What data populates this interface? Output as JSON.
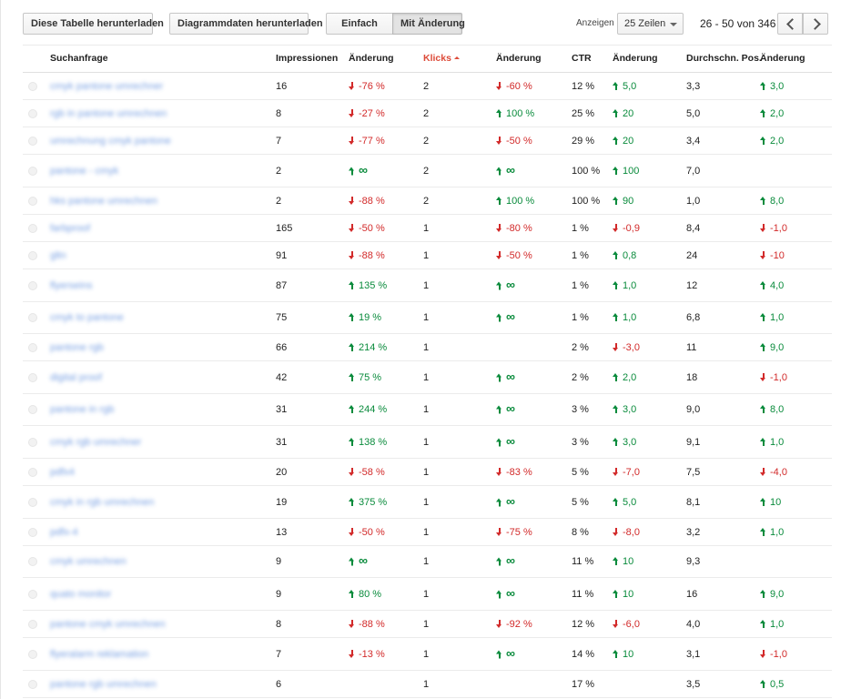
{
  "toolbar": {
    "download_table": "Diese Tabelle herunterladen",
    "download_chart": "Diagrammdaten herunterladen",
    "view_simple": "Einfach",
    "view_with_change": "Mit Änderung",
    "show_label": "Anzeigen",
    "rows_select": "25 Zeilen",
    "page_info": "26 - 50 von 346"
  },
  "columns": {
    "query": "Suchanfrage",
    "impressions": "Impressionen",
    "imp_change": "Änderung",
    "clicks": "Klicks",
    "clicks_change": "Änderung",
    "ctr": "CTR",
    "ctr_change": "Änderung",
    "avg_pos": "Durchschn. Pos.",
    "pos_change": "Änderung"
  },
  "rows": [
    {
      "query": "cmyk pantone umrechner",
      "imp": "16",
      "imp_chg": "-76 %",
      "imp_dir": "down",
      "clk": "2",
      "clk_chg": "-60 %",
      "clk_dir": "down",
      "ctr": "12 %",
      "ctr_chg": "5,0",
      "ctr_dir": "up",
      "pos": "3,3",
      "pos_chg": "3,0",
      "pos_dir": "up",
      "h": 30
    },
    {
      "query": "rgb in pantone umrechnen",
      "imp": "8",
      "imp_chg": "-27 %",
      "imp_dir": "down",
      "clk": "2",
      "clk_chg": "100 %",
      "clk_dir": "up",
      "ctr": "25 %",
      "ctr_chg": "20",
      "ctr_dir": "up",
      "pos": "5,0",
      "pos_chg": "2,0",
      "pos_dir": "up",
      "h": 30
    },
    {
      "query": "umrechnung cmyk pantone",
      "imp": "7",
      "imp_chg": "-77 %",
      "imp_dir": "down",
      "clk": "2",
      "clk_chg": "-50 %",
      "clk_dir": "down",
      "ctr": "29 %",
      "ctr_chg": "20",
      "ctr_dir": "up",
      "pos": "3,4",
      "pos_chg": "2,0",
      "pos_dir": "up",
      "h": 30
    },
    {
      "query": "pantone - cmyk",
      "imp": "2",
      "imp_chg": "∞",
      "imp_dir": "up",
      "clk": "2",
      "clk_chg": "∞",
      "clk_dir": "up",
      "ctr": "100 %",
      "ctr_chg": "100",
      "ctr_dir": "up",
      "pos": "7,0",
      "pos_chg": "",
      "pos_dir": "",
      "h": 36
    },
    {
      "query": "hks pantone umrechnen",
      "imp": "2",
      "imp_chg": "-88 %",
      "imp_dir": "down",
      "clk": "2",
      "clk_chg": "100 %",
      "clk_dir": "up",
      "ctr": "100 %",
      "ctr_chg": "90",
      "ctr_dir": "up",
      "pos": "1,0",
      "pos_chg": "8,0",
      "pos_dir": "up",
      "h": 30
    },
    {
      "query": "farbproof",
      "imp": "165",
      "imp_chg": "-50 %",
      "imp_dir": "down",
      "clk": "1",
      "clk_chg": "-80 %",
      "clk_dir": "down",
      "ctr": "1 %",
      "ctr_chg": "-0,9",
      "ctr_dir": "down",
      "pos": "8,4",
      "pos_chg": "-1,0",
      "pos_dir": "down",
      "h": 30
    },
    {
      "query": "gltn",
      "imp": "91",
      "imp_chg": "-88 %",
      "imp_dir": "down",
      "clk": "1",
      "clk_chg": "-50 %",
      "clk_dir": "down",
      "ctr": "1 %",
      "ctr_chg": "0,8",
      "ctr_dir": "up",
      "pos": "24",
      "pos_chg": "-10",
      "pos_dir": "down",
      "h": 30
    },
    {
      "query": "flyerseins",
      "imp": "87",
      "imp_chg": "135 %",
      "imp_dir": "up",
      "clk": "1",
      "clk_chg": "∞",
      "clk_dir": "up",
      "ctr": "1 %",
      "ctr_chg": "1,0",
      "ctr_dir": "up",
      "pos": "12",
      "pos_chg": "4,0",
      "pos_dir": "up",
      "h": 36
    },
    {
      "query": "cmyk to pantone",
      "imp": "75",
      "imp_chg": "19 %",
      "imp_dir": "up",
      "clk": "1",
      "clk_chg": "∞",
      "clk_dir": "up",
      "ctr": "1 %",
      "ctr_chg": "1,0",
      "ctr_dir": "up",
      "pos": "6,8",
      "pos_chg": "1,0",
      "pos_dir": "up",
      "h": 35
    },
    {
      "query": "pantone rgb",
      "imp": "66",
      "imp_chg": "214 %",
      "imp_dir": "up",
      "clk": "1",
      "clk_chg": "",
      "clk_dir": "",
      "ctr": "2 %",
      "ctr_chg": "-3,0",
      "ctr_dir": "down",
      "pos": "11",
      "pos_chg": "9,0",
      "pos_dir": "up",
      "h": 30
    },
    {
      "query": "digital proof",
      "imp": "42",
      "imp_chg": "75 %",
      "imp_dir": "up",
      "clk": "1",
      "clk_chg": "∞",
      "clk_dir": "up",
      "ctr": "2 %",
      "ctr_chg": "2,0",
      "ctr_dir": "up",
      "pos": "18",
      "pos_chg": "-1,0",
      "pos_dir": "down",
      "h": 36
    },
    {
      "query": "pantone in rgb",
      "imp": "31",
      "imp_chg": "244 %",
      "imp_dir": "up",
      "clk": "1",
      "clk_chg": "∞",
      "clk_dir": "up",
      "ctr": "3 %",
      "ctr_chg": "3,0",
      "ctr_dir": "up",
      "pos": "9,0",
      "pos_chg": "8,0",
      "pos_dir": "up",
      "h": 35
    },
    {
      "query": "cmyk rgb umrechner",
      "imp": "31",
      "imp_chg": "138 %",
      "imp_dir": "up",
      "clk": "1",
      "clk_chg": "∞",
      "clk_dir": "up",
      "ctr": "3 %",
      "ctr_chg": "3,0",
      "ctr_dir": "up",
      "pos": "9,1",
      "pos_chg": "1,0",
      "pos_dir": "up",
      "h": 36
    },
    {
      "query": "pdfx4",
      "imp": "20",
      "imp_chg": "-58 %",
      "imp_dir": "down",
      "clk": "1",
      "clk_chg": "-83 %",
      "clk_dir": "down",
      "ctr": "5 %",
      "ctr_chg": "-7,0",
      "ctr_dir": "down",
      "pos": "7,5",
      "pos_chg": "-4,0",
      "pos_dir": "down",
      "h": 30
    },
    {
      "query": "cmyk in rgb umrechnen",
      "imp": "19",
      "imp_chg": "375 %",
      "imp_dir": "up",
      "clk": "1",
      "clk_chg": "∞",
      "clk_dir": "up",
      "ctr": "5 %",
      "ctr_chg": "5,0",
      "ctr_dir": "up",
      "pos": "8,1",
      "pos_chg": "10",
      "pos_dir": "up",
      "h": 36
    },
    {
      "query": "pdfx-4",
      "imp": "13",
      "imp_chg": "-50 %",
      "imp_dir": "down",
      "clk": "1",
      "clk_chg": "-75 %",
      "clk_dir": "down",
      "ctr": "8 %",
      "ctr_chg": "-8,0",
      "ctr_dir": "down",
      "pos": "3,2",
      "pos_chg": "1,0",
      "pos_dir": "up",
      "h": 30
    },
    {
      "query": "cmyk umrechnen",
      "imp": "9",
      "imp_chg": "∞",
      "imp_dir": "up",
      "clk": "1",
      "clk_chg": "∞",
      "clk_dir": "up",
      "ctr": "11 %",
      "ctr_chg": "10",
      "ctr_dir": "up",
      "pos": "9,3",
      "pos_chg": "",
      "pos_dir": "",
      "h": 35
    },
    {
      "query": "quato monitor",
      "imp": "9",
      "imp_chg": "80 %",
      "imp_dir": "up",
      "clk": "1",
      "clk_chg": "∞",
      "clk_dir": "up",
      "ctr": "11 %",
      "ctr_chg": "10",
      "ctr_dir": "up",
      "pos": "16",
      "pos_chg": "9,0",
      "pos_dir": "up",
      "h": 36
    },
    {
      "query": "pantone cmyk umrechnen",
      "imp": "8",
      "imp_chg": "-88 %",
      "imp_dir": "down",
      "clk": "1",
      "clk_chg": "-92 %",
      "clk_dir": "down",
      "ctr": "12 %",
      "ctr_chg": "-6,0",
      "ctr_dir": "down",
      "pos": "4,0",
      "pos_chg": "1,0",
      "pos_dir": "up",
      "h": 30
    },
    {
      "query": "flyeralarm reklamation",
      "imp": "7",
      "imp_chg": "-13 %",
      "imp_dir": "down",
      "clk": "1",
      "clk_chg": "∞",
      "clk_dir": "up",
      "ctr": "14 %",
      "ctr_chg": "10",
      "ctr_dir": "up",
      "pos": "3,1",
      "pos_chg": "-1,0",
      "pos_dir": "down",
      "h": 36
    },
    {
      "query": "pantone rgb umrechnen",
      "imp": "6",
      "imp_chg": "",
      "imp_dir": "",
      "clk": "1",
      "clk_chg": "",
      "clk_dir": "",
      "ctr": "17 %",
      "ctr_chg": "",
      "ctr_dir": "",
      "pos": "3,5",
      "pos_chg": "0,5",
      "pos_dir": "up",
      "h": 30
    }
  ]
}
